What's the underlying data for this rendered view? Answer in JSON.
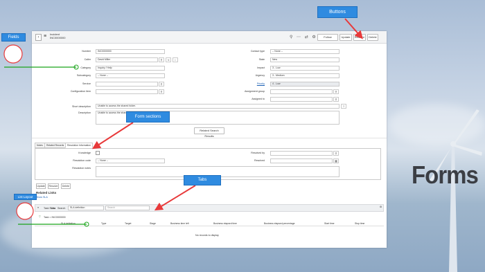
{
  "header": {
    "back_icon": "chevron-left-icon",
    "menu_icon": "hamburger-icon",
    "record_type": "Incident",
    "record_number": "INC0000000",
    "toolbar_icons": "⚲ ⋯ ⇄ ⚙",
    "follow": "Follow",
    "update": "Update",
    "resolve": "Resolve",
    "delete": "Delete"
  },
  "form_left": {
    "number_label": "Number",
    "number_value": "INC0000000",
    "caller_label": "Caller",
    "caller_value": "David Miller",
    "category_label": "Category",
    "category_value": "Inquiry / Help",
    "subcategory_label": "Subcategory",
    "subcategory_value": "-- None --",
    "service_label": "Service",
    "ci_label": "Configuration item"
  },
  "form_right": {
    "contact_label": "Contact type",
    "contact_value": "-- None --",
    "state_label": "State",
    "state_value": "New",
    "impact_label": "Impact",
    "impact_value": "3 - Low",
    "urgency_label": "Urgency",
    "urgency_value": "3 - Medium",
    "priority_label": "Priority",
    "priority_value": "4 - Low",
    "group_label": "Assignment group",
    "assigned_label": "Assigned to"
  },
  "desc": {
    "short_label": "Short description",
    "short_value": "Unable to access the shared folder.",
    "desc_label": "Description",
    "desc_value": "Unable to access the shared folder."
  },
  "related_search": "Related Search Results",
  "tabs": [
    "Notes",
    "Related Records",
    "Resolution Information"
  ],
  "resolution": {
    "knowledge_label": "Knowledge",
    "code_label": "Resolution code",
    "code_value": "-- None --",
    "notes_label": "Resolution notes",
    "resolved_by_label": "Resolved by",
    "resolved_label": "Resolved"
  },
  "actions": [
    "Update",
    "Resolve",
    "Delete"
  ],
  "related": {
    "heading": "Related Links",
    "sub": "Show SLA",
    "task_sla": "Task SLAs",
    "new": "New",
    "search_label": "Search",
    "filter_value": "SLA definition",
    "search_placeholder": "Search",
    "breadcrumb": "Task = INC0000000",
    "columns": [
      "SLA definition",
      "Type",
      "Target",
      "Stage",
      "Business time left",
      "Business elapsed time",
      "Business elapsed percentage",
      "Start time",
      "Stop time"
    ],
    "empty": "No records to display"
  },
  "annotations": {
    "fields": "Fields",
    "buttons": "Buttons",
    "form_sections": "Form sections",
    "tabs": "Tabs",
    "list_layout": "List Layout",
    "forms_title": "Forms"
  },
  "colors": {
    "callout": "#2f8be0",
    "arrow": "#e8393a",
    "highlight": "#19a319"
  }
}
